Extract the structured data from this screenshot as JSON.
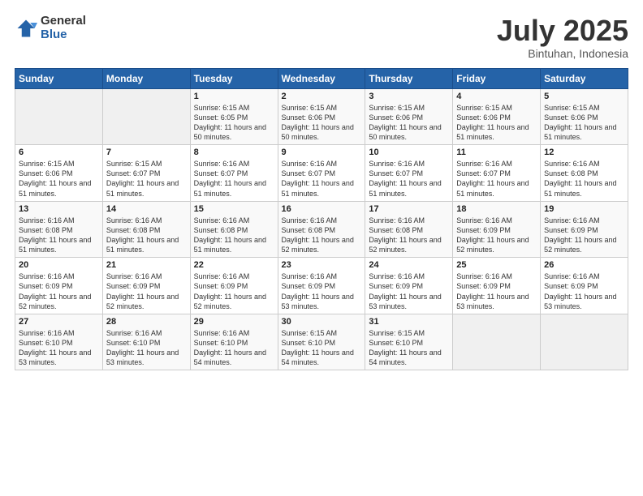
{
  "logo": {
    "general": "General",
    "blue": "Blue"
  },
  "title": "July 2025",
  "location": "Bintuhan, Indonesia",
  "days_of_week": [
    "Sunday",
    "Monday",
    "Tuesday",
    "Wednesday",
    "Thursday",
    "Friday",
    "Saturday"
  ],
  "weeks": [
    [
      {
        "day": "",
        "text": ""
      },
      {
        "day": "",
        "text": ""
      },
      {
        "day": "1",
        "text": "Sunrise: 6:15 AM\nSunset: 6:05 PM\nDaylight: 11 hours and 50 minutes."
      },
      {
        "day": "2",
        "text": "Sunrise: 6:15 AM\nSunset: 6:06 PM\nDaylight: 11 hours and 50 minutes."
      },
      {
        "day": "3",
        "text": "Sunrise: 6:15 AM\nSunset: 6:06 PM\nDaylight: 11 hours and 50 minutes."
      },
      {
        "day": "4",
        "text": "Sunrise: 6:15 AM\nSunset: 6:06 PM\nDaylight: 11 hours and 51 minutes."
      },
      {
        "day": "5",
        "text": "Sunrise: 6:15 AM\nSunset: 6:06 PM\nDaylight: 11 hours and 51 minutes."
      }
    ],
    [
      {
        "day": "6",
        "text": "Sunrise: 6:15 AM\nSunset: 6:06 PM\nDaylight: 11 hours and 51 minutes."
      },
      {
        "day": "7",
        "text": "Sunrise: 6:15 AM\nSunset: 6:07 PM\nDaylight: 11 hours and 51 minutes."
      },
      {
        "day": "8",
        "text": "Sunrise: 6:16 AM\nSunset: 6:07 PM\nDaylight: 11 hours and 51 minutes."
      },
      {
        "day": "9",
        "text": "Sunrise: 6:16 AM\nSunset: 6:07 PM\nDaylight: 11 hours and 51 minutes."
      },
      {
        "day": "10",
        "text": "Sunrise: 6:16 AM\nSunset: 6:07 PM\nDaylight: 11 hours and 51 minutes."
      },
      {
        "day": "11",
        "text": "Sunrise: 6:16 AM\nSunset: 6:07 PM\nDaylight: 11 hours and 51 minutes."
      },
      {
        "day": "12",
        "text": "Sunrise: 6:16 AM\nSunset: 6:08 PM\nDaylight: 11 hours and 51 minutes."
      }
    ],
    [
      {
        "day": "13",
        "text": "Sunrise: 6:16 AM\nSunset: 6:08 PM\nDaylight: 11 hours and 51 minutes."
      },
      {
        "day": "14",
        "text": "Sunrise: 6:16 AM\nSunset: 6:08 PM\nDaylight: 11 hours and 51 minutes."
      },
      {
        "day": "15",
        "text": "Sunrise: 6:16 AM\nSunset: 6:08 PM\nDaylight: 11 hours and 51 minutes."
      },
      {
        "day": "16",
        "text": "Sunrise: 6:16 AM\nSunset: 6:08 PM\nDaylight: 11 hours and 52 minutes."
      },
      {
        "day": "17",
        "text": "Sunrise: 6:16 AM\nSunset: 6:08 PM\nDaylight: 11 hours and 52 minutes."
      },
      {
        "day": "18",
        "text": "Sunrise: 6:16 AM\nSunset: 6:09 PM\nDaylight: 11 hours and 52 minutes."
      },
      {
        "day": "19",
        "text": "Sunrise: 6:16 AM\nSunset: 6:09 PM\nDaylight: 11 hours and 52 minutes."
      }
    ],
    [
      {
        "day": "20",
        "text": "Sunrise: 6:16 AM\nSunset: 6:09 PM\nDaylight: 11 hours and 52 minutes."
      },
      {
        "day": "21",
        "text": "Sunrise: 6:16 AM\nSunset: 6:09 PM\nDaylight: 11 hours and 52 minutes."
      },
      {
        "day": "22",
        "text": "Sunrise: 6:16 AM\nSunset: 6:09 PM\nDaylight: 11 hours and 52 minutes."
      },
      {
        "day": "23",
        "text": "Sunrise: 6:16 AM\nSunset: 6:09 PM\nDaylight: 11 hours and 53 minutes."
      },
      {
        "day": "24",
        "text": "Sunrise: 6:16 AM\nSunset: 6:09 PM\nDaylight: 11 hours and 53 minutes."
      },
      {
        "day": "25",
        "text": "Sunrise: 6:16 AM\nSunset: 6:09 PM\nDaylight: 11 hours and 53 minutes."
      },
      {
        "day": "26",
        "text": "Sunrise: 6:16 AM\nSunset: 6:09 PM\nDaylight: 11 hours and 53 minutes."
      }
    ],
    [
      {
        "day": "27",
        "text": "Sunrise: 6:16 AM\nSunset: 6:10 PM\nDaylight: 11 hours and 53 minutes."
      },
      {
        "day": "28",
        "text": "Sunrise: 6:16 AM\nSunset: 6:10 PM\nDaylight: 11 hours and 53 minutes."
      },
      {
        "day": "29",
        "text": "Sunrise: 6:16 AM\nSunset: 6:10 PM\nDaylight: 11 hours and 54 minutes."
      },
      {
        "day": "30",
        "text": "Sunrise: 6:15 AM\nSunset: 6:10 PM\nDaylight: 11 hours and 54 minutes."
      },
      {
        "day": "31",
        "text": "Sunrise: 6:15 AM\nSunset: 6:10 PM\nDaylight: 11 hours and 54 minutes."
      },
      {
        "day": "",
        "text": ""
      },
      {
        "day": "",
        "text": ""
      }
    ]
  ]
}
